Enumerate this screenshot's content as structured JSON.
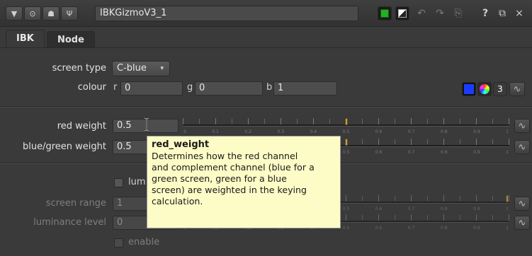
{
  "window": {
    "node_name": "IBKGizmoV3_1",
    "help_label": "?",
    "float_label": "ꝺ",
    "close_label": "×"
  },
  "tabs": [
    {
      "label": "IBK"
    },
    {
      "label": "Node"
    }
  ],
  "controls": {
    "screen_type": {
      "label": "screen type",
      "value": "C-blue"
    },
    "colour": {
      "label": "colour",
      "r_label": "r",
      "r_value": "0",
      "g_label": "g",
      "g_value": "0",
      "b_label": "b",
      "b_value": "1",
      "channel_count": "3"
    },
    "red_weight": {
      "label": "red weight",
      "value": "0.5"
    },
    "blue_green_weight": {
      "label": "blue/green weight",
      "value": "0.5"
    },
    "lum_checkbox": {
      "label": "lum"
    },
    "screen_range": {
      "label": "screen range",
      "value": "1"
    },
    "luminance_level": {
      "label": "luminance level",
      "value": "0"
    },
    "enable_checkbox": {
      "label": "enable"
    }
  },
  "slider_ticks": [
    "0",
    "0.1",
    "0.2",
    "0.3",
    "0.4",
    "0.5",
    "0.6",
    "0.7",
    "0.8",
    "0.9",
    "1"
  ],
  "tooltip": {
    "title": "red_weight",
    "line1": "Determines how the red channel",
    "line2": "and complement channel (blue for a",
    "line3": "green screen, green for a blue",
    "line4": "screen) are weighted in the keying",
    "line5": "calculation."
  },
  "colors": {
    "swatch_blue": "#1a3cff",
    "slider_handle": "#c8a24a",
    "tooltip_bg": "#fdfbc6",
    "node_color_green": "#22b022"
  }
}
